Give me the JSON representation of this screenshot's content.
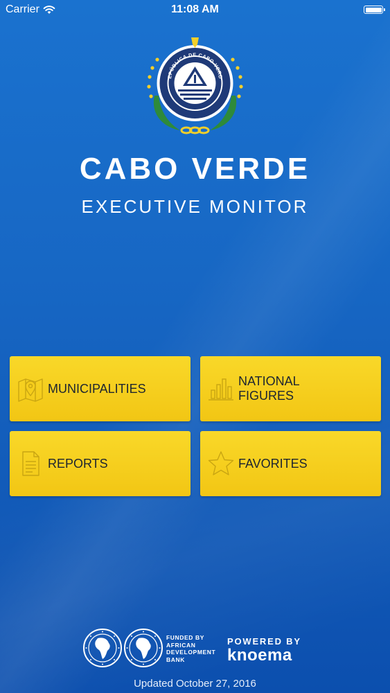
{
  "status_bar": {
    "carrier": "Carrier",
    "time": "11:08 AM",
    "battery_level": 1.0
  },
  "emblem": {
    "ring_text": "REPÚBLICA DE CABO VERDE",
    "colors": {
      "navy": "#1f3a78",
      "gold": "#f2cf2a",
      "green": "#2e8a3a"
    }
  },
  "header": {
    "title": "CABO VERDE",
    "subtitle": "EXECUTIVE MONITOR"
  },
  "tiles": [
    {
      "label": "MUNICIPALITIES",
      "icon": "map-pin-icon"
    },
    {
      "label_line1": "NATIONAL",
      "label_line2": "FIGURES",
      "icon": "bar-chart-icon"
    },
    {
      "label": "REPORTS",
      "icon": "document-icon"
    },
    {
      "label": "FAVORITES",
      "icon": "star-icon"
    }
  ],
  "footer": {
    "funded_by": [
      "FUNDED BY",
      "AFRICAN",
      "DEVELOPMENT",
      "BANK"
    ],
    "powered_by": "POWERED BY",
    "brand": "knoema",
    "updated": "Updated October 27, 2016"
  },
  "colors": {
    "background_top": "#1a72cf",
    "background_bottom": "#0c4fae",
    "tile_yellow": "#f5cd1c",
    "tile_text": "#1d2530"
  }
}
